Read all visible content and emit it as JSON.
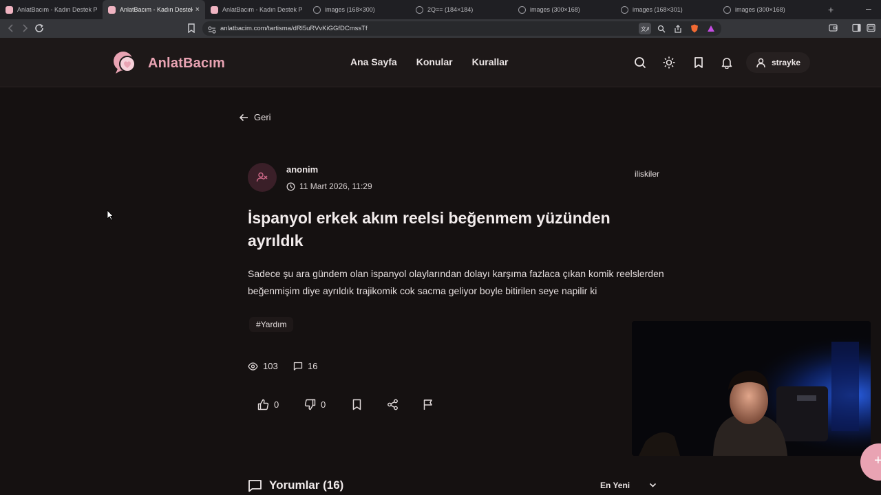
{
  "browser": {
    "tabs": [
      {
        "label": "AnlatBacım - Kadın Destek Platformu",
        "favicon": "site"
      },
      {
        "label": "AnlatBacım - Kadın Destek Platformu",
        "favicon": "site",
        "active": true
      },
      {
        "label": "AnlatBacım - Kadın Destek Platformu",
        "favicon": "site"
      },
      {
        "label": "images (168×300)",
        "favicon": "globe"
      },
      {
        "label": "2Q== (184×184)",
        "favicon": "globe"
      },
      {
        "label": "images (300×168)",
        "favicon": "globe"
      },
      {
        "label": "images (168×301)",
        "favicon": "globe"
      },
      {
        "label": "images (300×168)",
        "favicon": "globe"
      }
    ],
    "new_tab": "+",
    "minimize": "–",
    "url": "anlatbacim.com/tartisma/dRl5uRVvKiGGfDCmssTf"
  },
  "header": {
    "logo_text": "AnlatBacım",
    "nav": [
      "Ana Sayfa",
      "Konular",
      "Kurallar"
    ],
    "username": "strayke"
  },
  "post": {
    "back_label": "Geri",
    "author": "anonim",
    "date": "11 Mart 2026, 11:29",
    "category": "iliskiler",
    "title": "İspanyol erkek akım reelsi beğenmem yüzünden ayrıldık",
    "body": "Sadece şu ara gündem olan ispanyol olaylarından dolayı karşıma fazlaca çıkan komik reelslerden beğenmişim diye ayrıldık trajikomik cok sacma geliyor boyle bitirilen seye napilir ki",
    "tag": "#Yardım",
    "views": "103",
    "comments": "16",
    "likes": "0",
    "dislikes": "0"
  },
  "comments": {
    "title": "Yorumlar (16)",
    "sort_selected": "En Yeni"
  },
  "colors": {
    "accent": "#e9a3b3",
    "background": "#151111",
    "header_bg": "#1d1818"
  }
}
